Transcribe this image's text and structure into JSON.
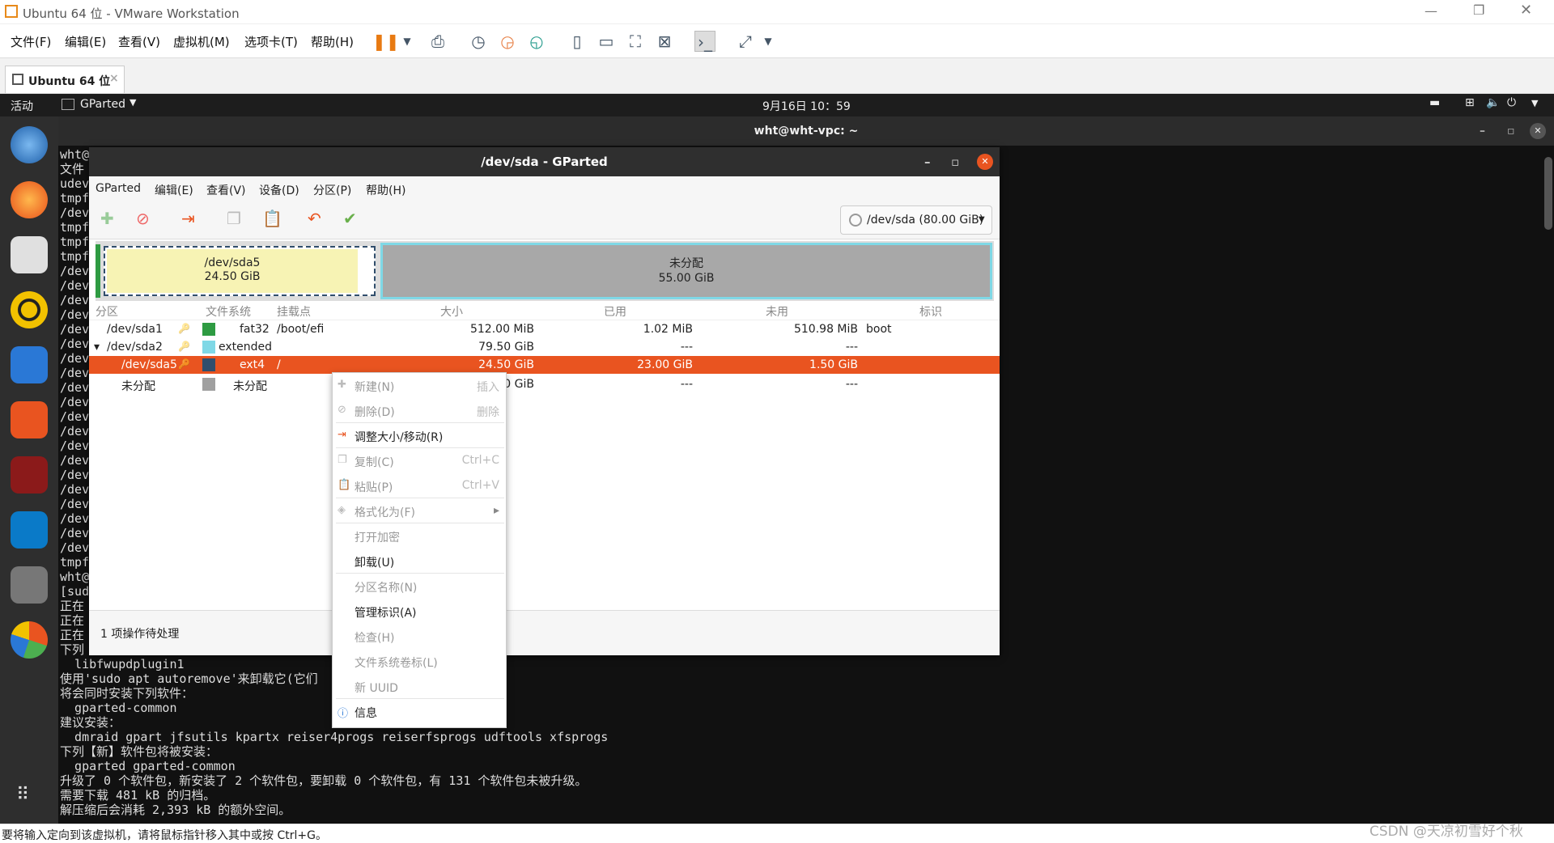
{
  "host": {
    "title": "Ubuntu 64 位 - VMware Workstation",
    "menus": [
      "文件(F)",
      "编辑(E)",
      "查看(V)",
      "虚拟机(M)",
      "选项卡(T)",
      "帮助(H)"
    ],
    "tab": "Ubuntu 64 位",
    "status": "要将输入定向到该虚拟机，请将鼠标指针移入其中或按 Ctrl+G。",
    "watermark": "CSDN @天凉初雪好个秋"
  },
  "guest": {
    "activities": "活动",
    "app": "GParted",
    "clock": "9月16日  10：59"
  },
  "terminal": {
    "title": "wht@wht-vpc: ~",
    "lines": [
      "wht@",
      "文件",
      "udev",
      "tmpf",
      "/dev",
      "tmpf",
      "tmpf",
      "tmpf",
      "/dev",
      "/dev",
      "/dev",
      "/dev",
      "/dev",
      "/dev",
      "/dev",
      "/dev",
      "/dev",
      "/dev",
      "/dev",
      "/dev",
      "/dev",
      "/dev",
      "/dev",
      "/dev",
      "/dev",
      "/dev",
      "/dev",
      "/dev",
      "tmpf",
      "wht@",
      "[sud",
      "正在",
      "正在",
      "正在",
      "下列",
      "  libfwupdplugin1",
      "使用'sudo apt autoremove'来卸载它(它们",
      "将会同时安装下列软件：",
      "  gparted-common",
      "建议安装：",
      "  dmraid gpart jfsutils kpartx reiser4progs reiserfsprogs udftools xfsprogs",
      "下列【新】软件包将被安装：",
      "  gparted gparted-common",
      "升级了 0 个软件包，新安装了 2 个软件包，要卸载 0 个软件包，有 131 个软件包未被升级。",
      "需要下载 481 kB 的归档。",
      "解压缩后会消耗 2,393 kB 的额外空间。"
    ]
  },
  "gparted": {
    "title": "/dev/sda - GParted",
    "menus": [
      "GParted",
      "编辑(E)",
      "查看(V)",
      "设备(D)",
      "分区(P)",
      "帮助(H)"
    ],
    "device": "/dev/sda (80.00 GiB)",
    "map": {
      "p1_name": "/dev/sda5",
      "p1_size": "24.50 GiB",
      "p2_name": "未分配",
      "p2_size": "55.00 GiB"
    },
    "columns": [
      "分区",
      "文件系统",
      "挂载点",
      "大小",
      "已用",
      "未用",
      "标识"
    ],
    "rows": [
      {
        "part": "/dev/sda1",
        "fs": "fat32",
        "mount": "/boot/efi",
        "size": "512.00 MiB",
        "used": "1.02 MiB",
        "unused": "510.98 MiB",
        "flags": "boot",
        "color": "#2e9b42"
      },
      {
        "part": "/dev/sda2",
        "fs": "extended",
        "mount": "",
        "size": "79.50 GiB",
        "used": "---",
        "unused": "---",
        "flags": "",
        "color": "#7fd8e6"
      },
      {
        "part": "/dev/sda5",
        "fs": "ext4",
        "mount": "/",
        "size": "24.50 GiB",
        "used": "23.00 GiB",
        "unused": "1.50 GiB",
        "flags": "",
        "color": "#314e6c"
      },
      {
        "part": "未分配",
        "fs": "未分配",
        "mount": "",
        "size": "0 GiB",
        "used": "---",
        "unused": "---",
        "flags": "",
        "color": "#a0a0a0"
      }
    ],
    "pending": "1 项操作待处理"
  },
  "context": [
    {
      "label": "新建(N)",
      "shortcut": "插入",
      "disabled": true
    },
    {
      "label": "删除(D)",
      "shortcut": "删除",
      "disabled": true
    },
    {
      "label": "调整大小/移动(R)",
      "shortcut": "",
      "disabled": false
    },
    {
      "label": "复制(C)",
      "shortcut": "Ctrl+C",
      "disabled": true
    },
    {
      "label": "粘贴(P)",
      "shortcut": "Ctrl+V",
      "disabled": true
    },
    {
      "label": "格式化为(F)",
      "shortcut": "",
      "disabled": true
    },
    {
      "label": "打开加密",
      "shortcut": "",
      "disabled": true
    },
    {
      "label": "卸载(U)",
      "shortcut": "",
      "disabled": false
    },
    {
      "label": "分区名称(N)",
      "shortcut": "",
      "disabled": true
    },
    {
      "label": "管理标识(A)",
      "shortcut": "",
      "disabled": false
    },
    {
      "label": "检查(H)",
      "shortcut": "",
      "disabled": true
    },
    {
      "label": "文件系统卷标(L)",
      "shortcut": "",
      "disabled": true
    },
    {
      "label": "新 UUID",
      "shortcut": "",
      "disabled": true
    },
    {
      "label": "信息",
      "shortcut": "",
      "disabled": false
    }
  ],
  "colors": {
    "accent": "#e95420",
    "terminal_bg": "#111111",
    "dock_bg": "#2e2e2e"
  }
}
